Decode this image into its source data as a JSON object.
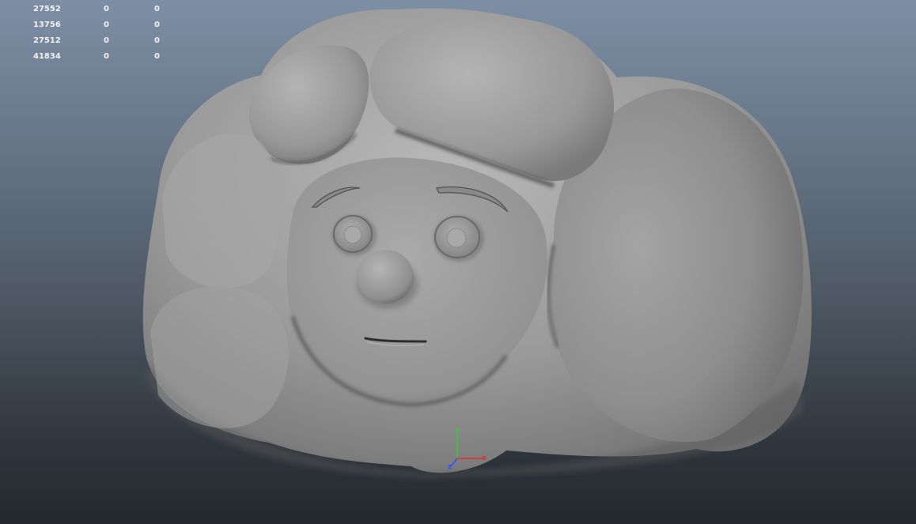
{
  "hud": {
    "rows": [
      [
        "27552",
        "0",
        "0"
      ],
      [
        "13756",
        "0",
        "0"
      ],
      [
        "27512",
        "0",
        "0"
      ],
      [
        "41834",
        "0",
        "0"
      ]
    ]
  },
  "axis": {
    "y_label": "y",
    "x_label": "x",
    "z_label": "z",
    "colors": {
      "x": "#e03030",
      "y": "#30d030",
      "z": "#3050ff"
    }
  }
}
